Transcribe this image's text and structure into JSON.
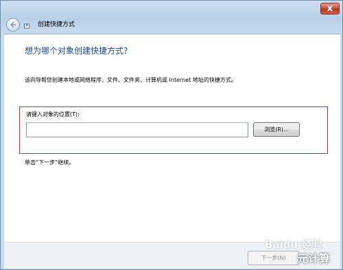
{
  "window": {
    "title": "创建快捷方式",
    "close_label": "x"
  },
  "content": {
    "heading": "想为哪个对象创建快捷方式?",
    "description": "该向导帮您创建本地或网络程序、文件、文件夹、计算机或 Internet 地址的快捷方式。",
    "location_label": "请键入对象的位置(T):",
    "location_value": "",
    "browse_label": "浏览(R)...",
    "hint": "单击“下一步”继续。"
  },
  "footer": {
    "next_label": "下一步(N)"
  },
  "overlay": {
    "watermark_top": "Baidu 经验",
    "watermark_bottom": "元计算"
  },
  "colors": {
    "heading": "#1e4a9a",
    "highlight_border": "#e02020",
    "close_button": "#c8513d"
  }
}
